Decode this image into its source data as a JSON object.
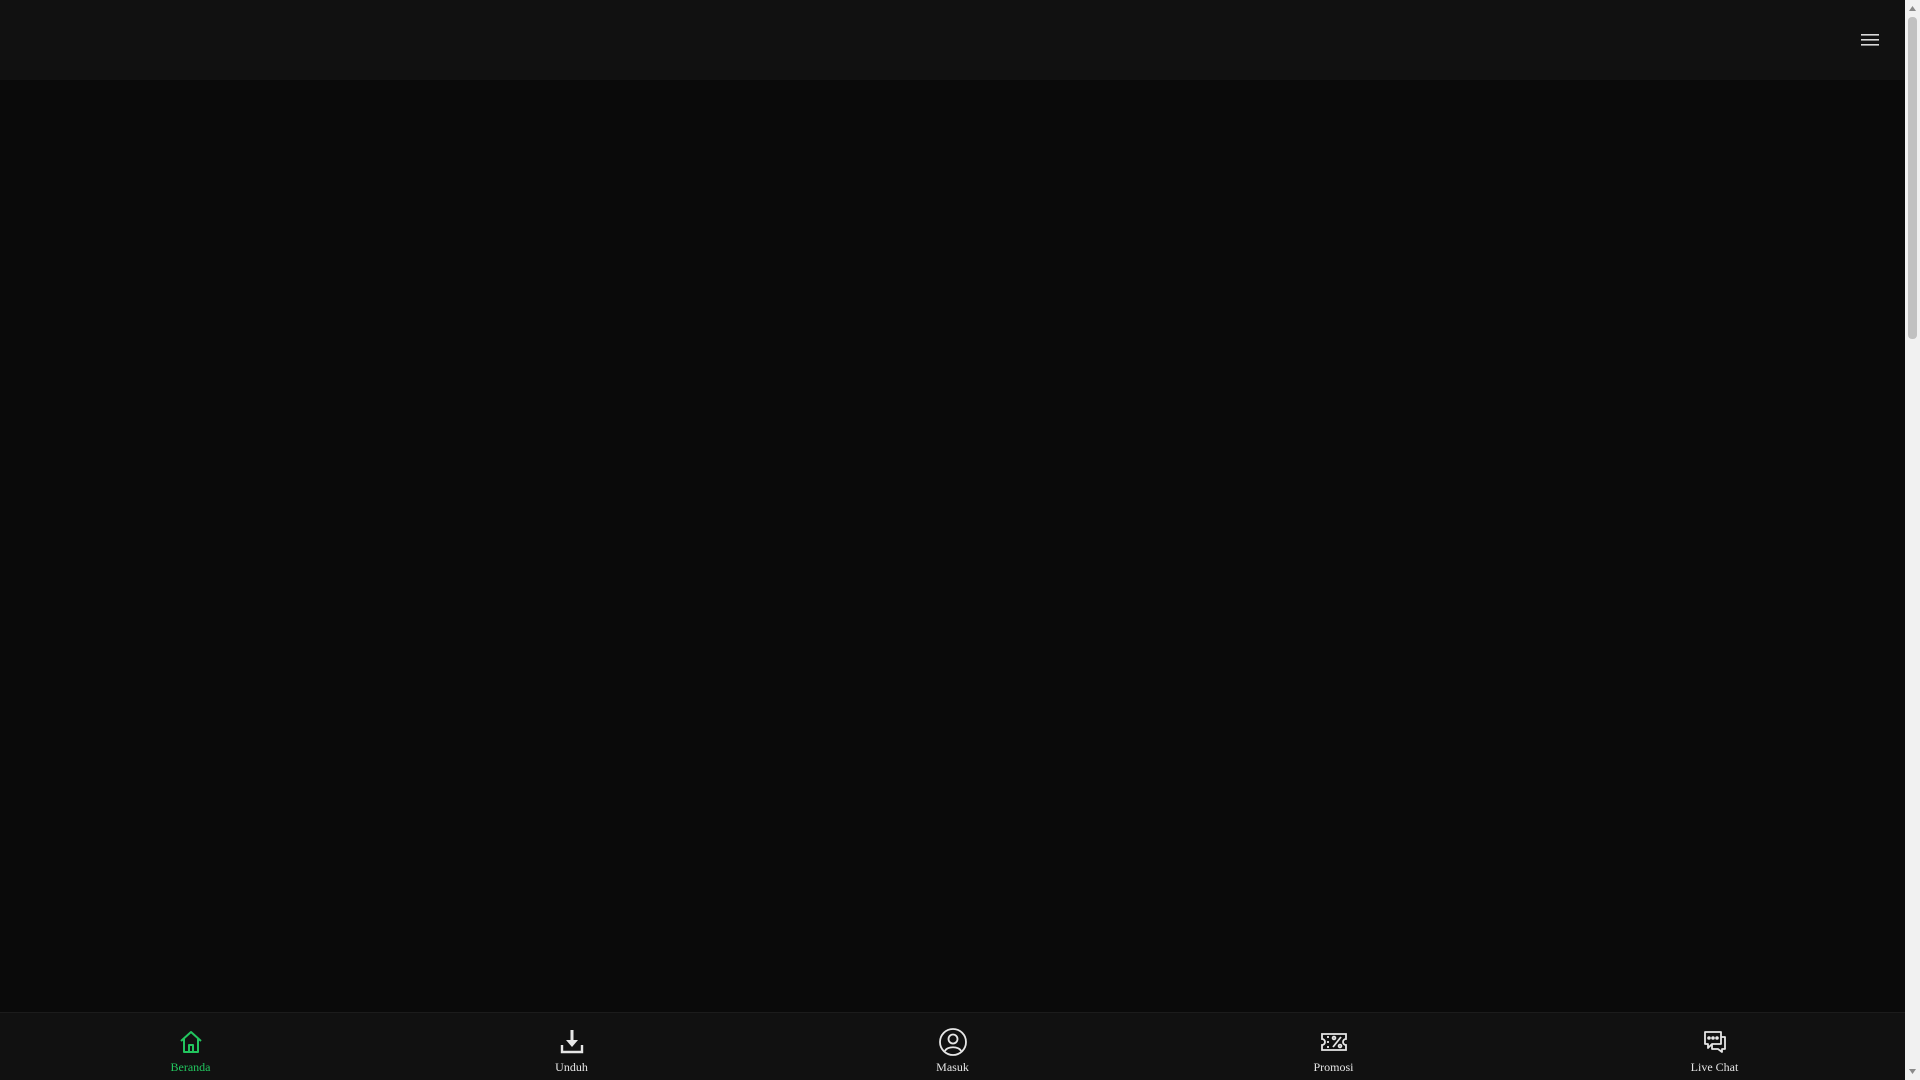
{
  "header": {
    "menu_icon": "hamburger-menu-icon"
  },
  "bottom_nav": {
    "items": [
      {
        "label": "Beranda",
        "icon": "home-icon",
        "active": true
      },
      {
        "label": "Unduh",
        "icon": "download-icon",
        "active": false
      },
      {
        "label": "Masuk",
        "icon": "user-circle-icon",
        "active": false
      },
      {
        "label": "Promosi",
        "icon": "percent-ticket-icon",
        "active": false
      },
      {
        "label": "Live Chat",
        "icon": "chat-bubbles-icon",
        "active": false
      }
    ]
  },
  "colors": {
    "background": "#0a0a0a",
    "bar": "#111111",
    "accent": "#22c55e",
    "text": "#e6e6e6"
  }
}
